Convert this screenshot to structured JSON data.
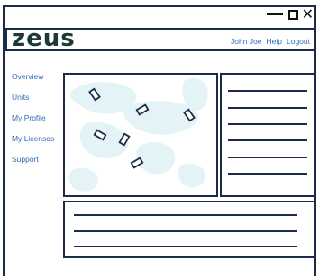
{
  "window": {
    "controls": {
      "minimize_icon": "minimize-icon",
      "maximize_icon": "maximize-icon",
      "close_icon": "close-icon",
      "close_glyph": "✕"
    }
  },
  "app": {
    "logo_text": "zeus",
    "top_nav": {
      "user": "John Joe",
      "help": "Help",
      "logout": "Logout"
    }
  },
  "sidebar": {
    "items": [
      {
        "label": "Overview"
      },
      {
        "label": "Units"
      },
      {
        "label": "My Profile"
      },
      {
        "label": "My Licenses"
      },
      {
        "label": "Support"
      }
    ]
  },
  "colors": {
    "border": "#1d2b4a",
    "link": "#2f6fba",
    "logo": "#1c3a36",
    "map_land": "#e4f4f6"
  },
  "map": {
    "markers": [
      {
        "id": 1,
        "icon": "unit-marker-icon"
      },
      {
        "id": 2,
        "icon": "unit-marker-icon"
      },
      {
        "id": 3,
        "icon": "unit-marker-icon"
      },
      {
        "id": 4,
        "icon": "unit-marker-icon"
      },
      {
        "id": 5,
        "icon": "unit-marker-icon"
      },
      {
        "id": 6,
        "icon": "unit-marker-icon"
      }
    ]
  }
}
